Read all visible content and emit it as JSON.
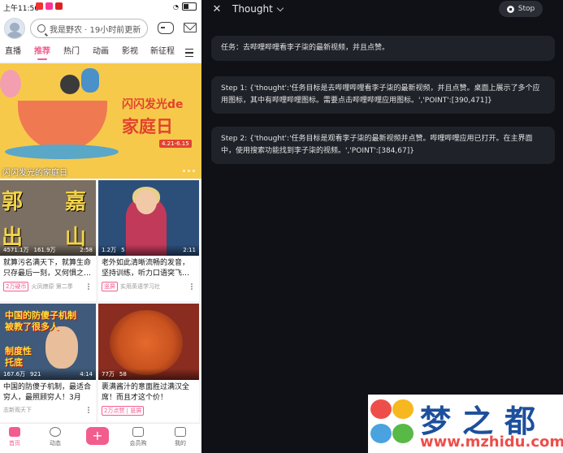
{
  "phone": {
    "status": {
      "time": "上午11:56"
    },
    "search": {
      "placeholder_text": "我是野农 · 19小时前更新"
    },
    "tabs": [
      "直播",
      "推荐",
      "热门",
      "动画",
      "影视",
      "新征程"
    ],
    "active_tab": "推荐",
    "banner": {
      "title_line1": "闪闪发光de",
      "title_line2": "家庭日",
      "date": "4.21-6.15",
      "caption": "闪闪发光的家庭日"
    },
    "cards": [
      {
        "overlay_text": [
          "郭",
          "嘉",
          "出",
          "山"
        ],
        "views": "4571.1万",
        "comments": "161.9万",
        "duration": "2:58",
        "title": "就算污名满天下，就算生命只存最后一刻，又何惧之…",
        "badge": "2万硬币",
        "author": "火凤燎原 第二季"
      },
      {
        "overlay_text": [],
        "views": "1.2万",
        "comments": "5",
        "duration": "2:11",
        "title": "老外如此清晰流畅的发音，坚持训练，听力口语突飞…",
        "badge": "竖屏",
        "author": "实用英语学习社"
      },
      {
        "overlay_text": [
          "中国的防傻子机制",
          "被教了很多人",
          "制度性",
          "托底"
        ],
        "views": "167.6万",
        "comments": "921",
        "duration": "4:14",
        "title": "中国的防傻子机制，最适合穷人，最照顾穷人！3月1…",
        "badge": "",
        "author": "志新观天下"
      },
      {
        "overlay_text": [],
        "views": "77万",
        "comments": "58",
        "duration": "",
        "title": "裹满酱汁的意面胜过满汉全席！而且才这个价！",
        "badge": "2万点赞 | 竖屏",
        "author": ""
      }
    ],
    "bottom_nav": [
      "首页",
      "动态",
      "会员购",
      "我的"
    ],
    "active_nav": "首页"
  },
  "agent": {
    "model_label": "Thought",
    "stop_label": "Stop",
    "messages": [
      "任务：去哔哩哔哩看李子柒的最新视频，并且点赞。",
      "Step 1: {'thought':'任务目标是去哔哩哔哩看李子柒的最新视频，并且点赞。桌面上展示了多个应用图标，其中有哔哩哔哩图标。需要点击哔哩哔哩应用图标。','POINT':[390,471]}",
      "Step 2: {'thought':'任务目标是观看李子柒的最新视频并点赞。哔哩哔哩应用已打开。在主界面中，使用搜索功能找到李子柒的视频。','POINT':[384,67]}"
    ]
  },
  "watermark": {
    "title": "梦之都",
    "url": "www.mzhidu.com"
  },
  "colors": {
    "accent": "#f25d8e",
    "agent_bg": "#0f1116",
    "bubble_bg": "#1f2229"
  }
}
